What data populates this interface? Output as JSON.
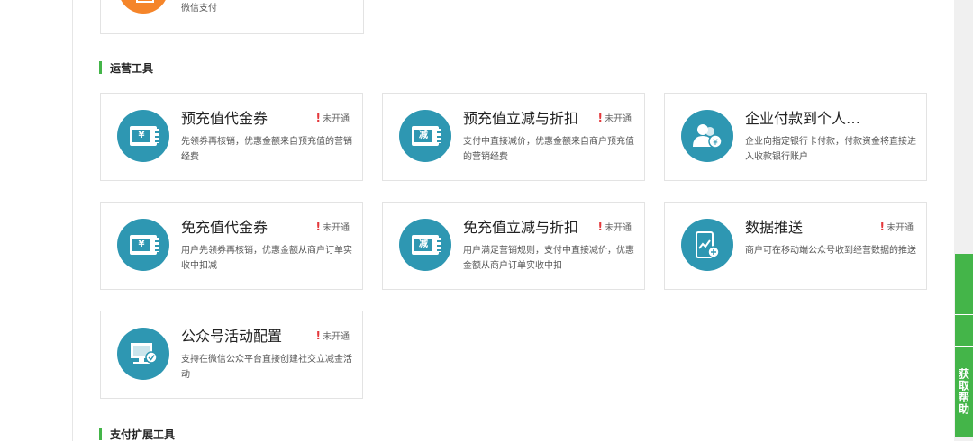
{
  "top_card": {
    "subtitle": "微信支付"
  },
  "sections": [
    {
      "title": "运营工具"
    },
    {
      "title": "支付扩展工具"
    }
  ],
  "cards": [
    {
      "title": "预充值代金券",
      "status": "未开通",
      "desc": "先领券再核销，优惠金额来自预充值的营销经费",
      "icon": "ticket-yen-icon",
      "icon_text": "¥"
    },
    {
      "title": "预充值立减与折扣",
      "status": "未开通",
      "desc": "支付中直接减价，优惠金额来自商户预充值的营销经费",
      "icon": "ticket-discount-icon",
      "icon_text": "减"
    },
    {
      "title": "企业付款到个人…",
      "status": "",
      "desc": "企业向指定银行卡付款，付款资金将直接进入收款银行账户",
      "icon": "enterprise-payment-icon"
    },
    {
      "title": "免充值代金券",
      "status": "未开通",
      "desc": "用户先领券再核销，优惠金额从商户订单实收中扣减",
      "icon": "ticket-yen-icon",
      "icon_text": "¥"
    },
    {
      "title": "免充值立减与折扣",
      "status": "未开通",
      "desc": "用户满足营销规则，支付中直接减价，优惠金额从商户订单实收中扣",
      "icon": "ticket-discount-icon",
      "icon_text": "减"
    },
    {
      "title": "数据推送",
      "status": "未开通",
      "desc": "商户可在移动端公众号收到经营数据的推送",
      "icon": "mobile-data-icon"
    },
    {
      "title": "公众号活动配置",
      "status": "未开通",
      "desc": "支持在微信公众平台直接创建社交立减金活动",
      "icon": "monitor-config-icon"
    }
  ],
  "right_rail": {
    "help_label": "获取帮助"
  },
  "colors": {
    "accent_green": "#44b549",
    "icon_blue": "#2e97b2",
    "status_red": "#e4393c",
    "top_icon_orange": "#f5852a"
  }
}
